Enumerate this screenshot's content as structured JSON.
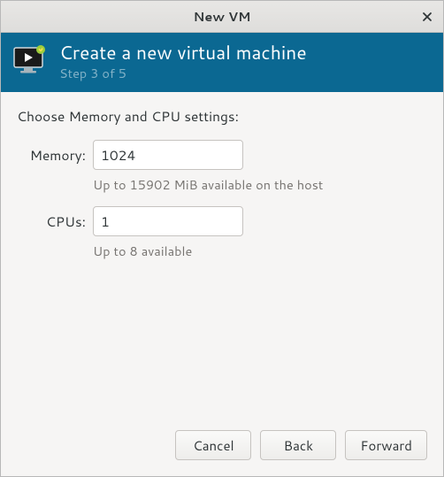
{
  "window": {
    "title": "New VM"
  },
  "header": {
    "title": "Create a new virtual machine",
    "step": "Step 3 of 5"
  },
  "instruction": "Choose Memory and CPU settings:",
  "form": {
    "memory": {
      "label": "Memory:",
      "value": "1024",
      "hint": "Up to 15902 MiB available on the host"
    },
    "cpus": {
      "label": "CPUs:",
      "value": "1",
      "hint": "Up to 8 available"
    }
  },
  "buttons": {
    "cancel": "Cancel",
    "back": "Back",
    "forward": "Forward"
  }
}
